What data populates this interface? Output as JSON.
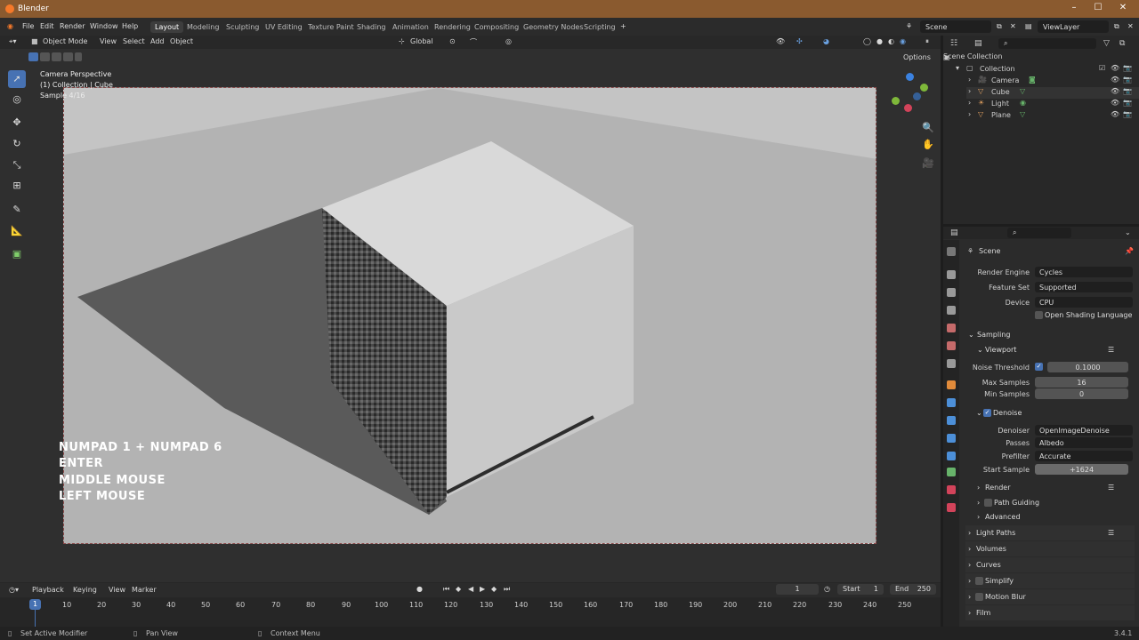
{
  "window": {
    "title": "Blender"
  },
  "menu": [
    "File",
    "Edit",
    "Render",
    "Window",
    "Help"
  ],
  "workspaces": [
    "Layout",
    "Modeling",
    "Sculpting",
    "UV Editing",
    "Texture Paint",
    "Shading",
    "Animation",
    "Rendering",
    "Compositing",
    "Geometry Nodes",
    "Scripting"
  ],
  "active_workspace": "Layout",
  "scene": {
    "name": "Scene",
    "view_layer": "ViewLayer"
  },
  "viewport_header": {
    "mode": "Object Mode",
    "menus": [
      "View",
      "Select",
      "Add",
      "Object"
    ],
    "transform_orientation": "Global",
    "options_label": "Options"
  },
  "viewport_overlay": {
    "line1": "Camera Perspective",
    "line2": "(1) Collection | Cube",
    "line3": "Sample 4/16"
  },
  "keycast": [
    "NUMPAD 1 + NUMPAD 6",
    "ENTER",
    "MIDDLE MOUSE",
    "LEFT MOUSE"
  ],
  "outliner": {
    "root": "Scene Collection",
    "collection": "Collection",
    "items": [
      "Camera",
      "Cube",
      "Light",
      "Plane"
    ]
  },
  "properties": {
    "context": "Scene",
    "render_engine_label": "Render Engine",
    "render_engine": "Cycles",
    "feature_set_label": "Feature Set",
    "feature_set": "Supported",
    "device_label": "Device",
    "device": "CPU",
    "osl_label": "Open Shading Language",
    "sampling": "Sampling",
    "viewport": "Viewport",
    "noise_threshold_label": "Noise Threshold",
    "noise_threshold": "0.1000",
    "max_samples_label": "Max Samples",
    "max_samples": "16",
    "min_samples_label": "Min Samples",
    "min_samples": "0",
    "denoise": "Denoise",
    "denoiser_label": "Denoiser",
    "denoiser": "OpenImageDenoise",
    "passes_label": "Passes",
    "passes": "Albedo",
    "prefilter_label": "Prefilter",
    "prefilter": "Accurate",
    "start_sample_label": "Start Sample",
    "start_sample": "+1624",
    "render": "Render",
    "path_guiding": "Path Guiding",
    "advanced": "Advanced",
    "sections": [
      "Light Paths",
      "Volumes",
      "Curves",
      "Simplify",
      "Motion Blur",
      "Film"
    ]
  },
  "timeline": {
    "menus": [
      "Playback",
      "Keying",
      "View",
      "Marker"
    ],
    "current_frame": "1",
    "start_label": "Start",
    "start": "1",
    "end_label": "End",
    "end": "250",
    "ticks": [
      "1",
      "10",
      "20",
      "30",
      "40",
      "50",
      "60",
      "70",
      "80",
      "90",
      "100",
      "110",
      "120",
      "130",
      "140",
      "150",
      "160",
      "170",
      "180",
      "190",
      "200",
      "210",
      "220",
      "230",
      "240",
      "250"
    ]
  },
  "status": {
    "left": "Set Active Modifier",
    "middle": "Pan View",
    "right": "Context Menu",
    "version": "3.4.1"
  }
}
